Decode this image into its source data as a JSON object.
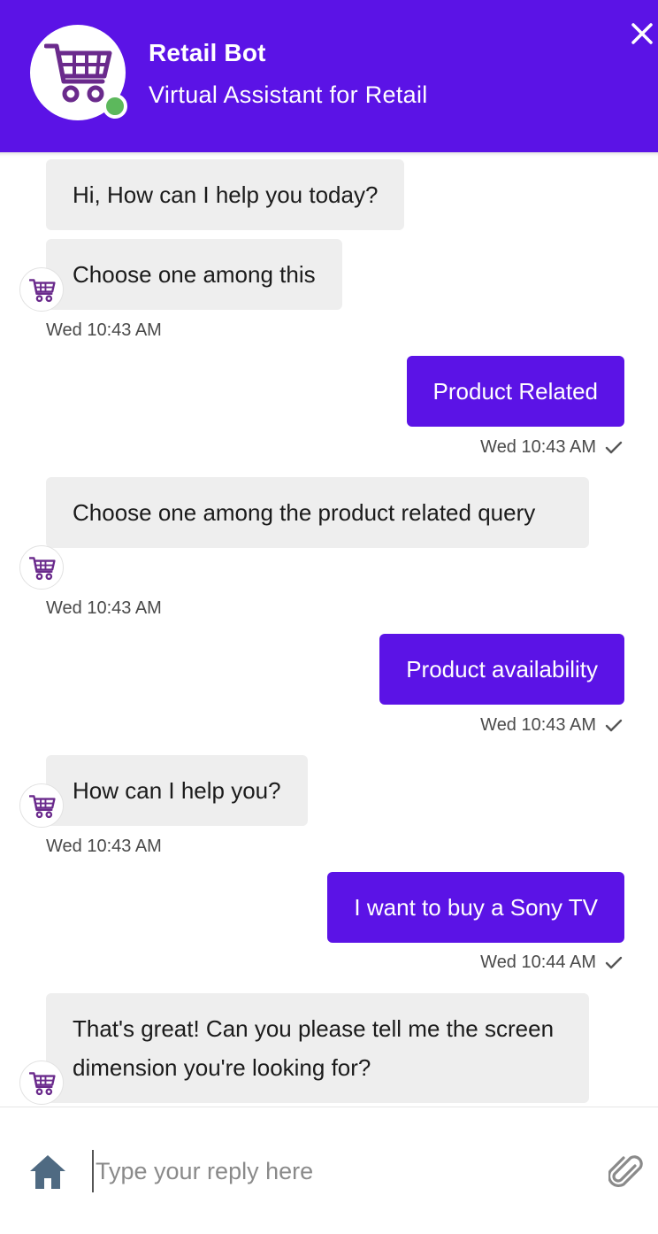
{
  "header": {
    "title": "Retail Bot",
    "subtitle": "Virtual Assistant for Retail",
    "status_color": "#5cb85c",
    "brand_color": "#5b13e6",
    "close_icon": "close-icon"
  },
  "messages": [
    {
      "from": "bot",
      "text": "Hi, How can I help you today?"
    },
    {
      "from": "bot",
      "text": "Choose one among this",
      "time": "Wed 10:43 AM"
    },
    {
      "from": "user",
      "text": "Product Related",
      "time": "Wed 10:43 AM"
    },
    {
      "from": "bot",
      "text": "Choose one among the product related query",
      "time": "Wed 10:43 AM"
    },
    {
      "from": "user",
      "text": "Product availability",
      "time": "Wed 10:43 AM"
    },
    {
      "from": "bot",
      "text": "How can I help you?",
      "time": "Wed 10:43 AM"
    },
    {
      "from": "user",
      "text": "I want to buy a Sony TV",
      "time": "Wed 10:44 AM"
    },
    {
      "from": "bot",
      "text": "That's great! Can you please tell me the screen dimension you're looking for?"
    }
  ],
  "composer": {
    "placeholder": "Type your reply here",
    "home_icon": "home-icon",
    "attach_icon": "paperclip-icon"
  }
}
